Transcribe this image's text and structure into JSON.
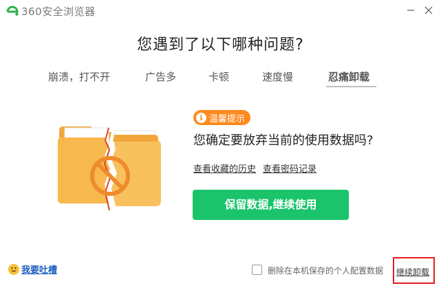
{
  "window": {
    "app_name": "360安全浏览器",
    "minimize_icon": "minimize-icon",
    "close_icon": "close-icon"
  },
  "heading": "您遇到了以下哪种问题?",
  "tabs": [
    {
      "label": "崩溃，打不开"
    },
    {
      "label": "广告多"
    },
    {
      "label": "卡顿"
    },
    {
      "label": "速度慢"
    },
    {
      "label": "忍痛卸载",
      "active": true
    }
  ],
  "tip": {
    "badge_icon": "i",
    "badge_label": "温馨提示"
  },
  "question": "您确定要放弃当前的使用数据吗?",
  "links": {
    "favorites_history": "查看收藏的历史",
    "password_records": "查看密码记录"
  },
  "primary_button": "保留数据,继续使用",
  "footer": {
    "feedback_label": "我要吐槽",
    "delete_config_label": "删除在本机保存的个人配置数据",
    "delete_config_checked": false,
    "continue_uninstall_label": "继续卸载"
  },
  "colors": {
    "primary_green": "#1bc46b",
    "tip_orange": "#ff8a1e",
    "folder_orange": "#f7b84d",
    "highlight_red": "#e21d1d",
    "link_blue": "#1f5fbf"
  }
}
